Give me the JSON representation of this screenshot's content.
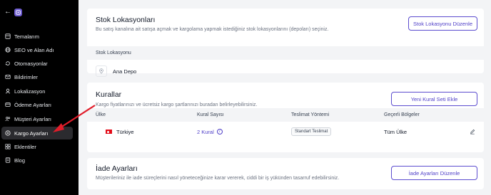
{
  "sidebar": {
    "items": [
      {
        "label": "Temalarım",
        "icon": "layout-icon"
      },
      {
        "label": "SEO ve Alan Adı",
        "icon": "globe-icon"
      },
      {
        "label": "Otomasyonlar",
        "icon": "automation-icon"
      },
      {
        "label": "Bildirimler",
        "icon": "mail-icon"
      },
      {
        "label": "Lokalizasyon",
        "icon": "localization-icon"
      },
      {
        "label": "Ödeme Ayarları",
        "icon": "payment-icon"
      },
      {
        "label": "Müşteri Ayarları",
        "icon": "users-icon"
      },
      {
        "label": "Kargo Ayarları",
        "icon": "cargo-icon",
        "active": true
      },
      {
        "label": "Eklentiler",
        "icon": "grid-icon"
      },
      {
        "label": "Blog",
        "icon": "blog-icon"
      }
    ]
  },
  "stock": {
    "title": "Stok Lokasyonları",
    "subtitle": "Bu satış kanalına ait satışa açmak ve kargolama yapmak istediğiniz stok lokasyonlarını (depoları) seçiniz.",
    "button": "Stok Lokasyonu Düzenle",
    "column": "Stok Lokasyonu",
    "location": "Ana Depo"
  },
  "rules": {
    "title": "Kurallar",
    "subtitle": "Kargo fiyatlarınızı ve ücretsiz kargo şartlarınızı buradan belirleyebilirsiniz.",
    "button": "Yeni Kural Seti Ekle",
    "columns": [
      "Ülke",
      "Kural Sayısı",
      "Teslimat Yöntemi",
      "Geçerli Bölgeler"
    ],
    "row": {
      "country": "Türkiye",
      "rule_count": "2 Kural",
      "method": "Standart Teslimat",
      "regions": "Tüm Ülke"
    }
  },
  "returns": {
    "title": "İade Ayarları",
    "subtitle": "Müşterileriniz ile iade süreçlerini nasıl yöneteceğinize karar vererek, ciddi bir iş yükünden tasarruf edebilirsiniz.",
    "button": "İade Ayarları Düzenle"
  },
  "colors": {
    "accent": "#4f3fc8",
    "annotation_arrow": "#e11d2a",
    "sidebar_bg": "#000000"
  }
}
